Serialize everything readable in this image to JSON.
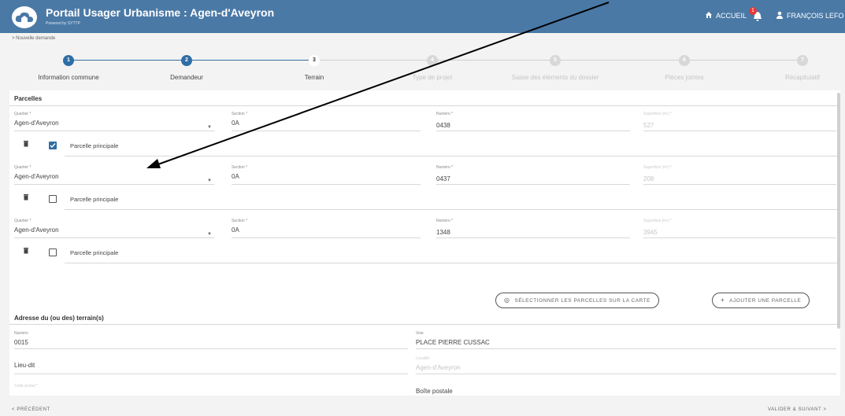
{
  "header": {
    "title": "Portail Usager Urbanisme : Agen-d'Aveyron",
    "subtitle": "Powered by SYTTP",
    "nav_home": "ACCUEIL",
    "notif_count": "1",
    "nav_user": "FRANÇOIS LEFO"
  },
  "breadcrumb": "> Nouvelle demande",
  "steps": [
    {
      "num": "1",
      "label": "Information commune",
      "state": "done"
    },
    {
      "num": "2",
      "label": "Demandeur",
      "state": "done"
    },
    {
      "num": "3",
      "label": "Terrain",
      "state": "current"
    },
    {
      "num": "4",
      "label": "Type de projet",
      "state": "future"
    },
    {
      "num": "5",
      "label": "Saisie des éléments du dossier",
      "state": "future"
    },
    {
      "num": "6",
      "label": "Pièces jointes",
      "state": "future"
    },
    {
      "num": "7",
      "label": "Récapitulatif",
      "state": "future"
    }
  ],
  "parcelles": {
    "section_title": "Parcelles",
    "labels": {
      "quartier": "Quartier *",
      "section": "Section *",
      "numero": "Numéro *",
      "surface": "Superficie (m²) *",
      "principale": "Parcelle principale"
    },
    "rows": [
      {
        "quartier": "Agen-d'Aveyron",
        "section": "0A",
        "numero": "0438",
        "surface": "527",
        "principale": true
      },
      {
        "quartier": "Agen-d'Aveyron",
        "section": "0A",
        "numero": "0437",
        "surface": "208",
        "principale": false
      },
      {
        "quartier": "Agen-d'Aveyron",
        "section": "0A",
        "numero": "1348",
        "surface": "3945",
        "principale": false
      }
    ],
    "select_on_map_button": "SÉLECTIONNER LES PARCELLES SUR LA CARTE",
    "add_parcel_button": "AJOUTER UNE PARCELLE"
  },
  "adresse": {
    "section_title": "Adresse du (ou des) terrain(s)",
    "numero_label": "Numéro",
    "numero_value": "0015",
    "voie_label": "Voie",
    "voie_value": "PLACE PIERRE CUSSAC",
    "lieu_dit_value": "Lieu-dit",
    "localite_label": "Localité",
    "localite_value": "Agen-d'Aveyron",
    "code_postal_label": "Code postal *",
    "boite_postale_value": "Boîte postale"
  },
  "footer": {
    "prev_button": "< PRÉCÉDENT",
    "next_button": "VALIDER & SUIVANT >"
  },
  "colors": {
    "header_bg": "#4a79a6",
    "primary": "#2f6ea5",
    "badge": "#e53935"
  }
}
